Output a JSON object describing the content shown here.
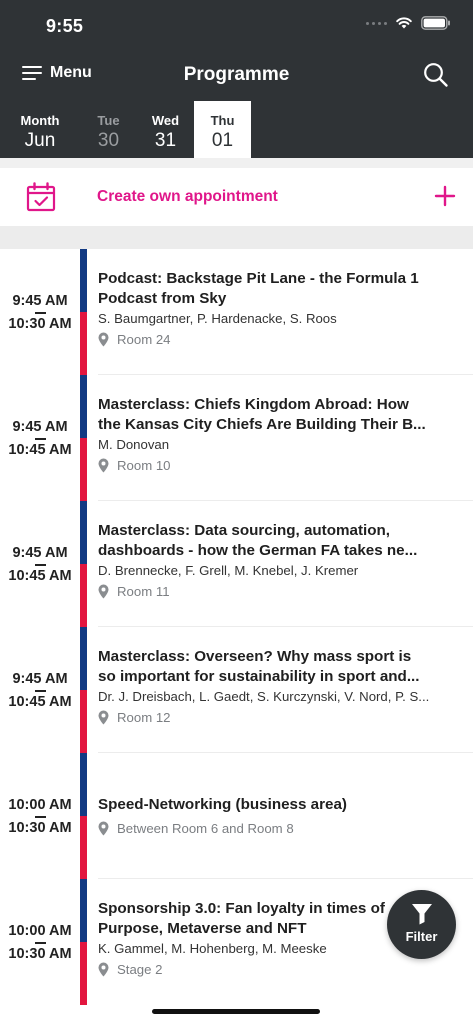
{
  "status": {
    "time": "9:55"
  },
  "nav": {
    "menu_label": "Menu",
    "title": "Programme"
  },
  "date_tabs": [
    {
      "top": "Month",
      "bottom": "Jun"
    },
    {
      "top": "Tue",
      "bottom": "30"
    },
    {
      "top": "Wed",
      "bottom": "31"
    },
    {
      "top": "Thu",
      "bottom": "01"
    }
  ],
  "create": {
    "label": "Create own appointment"
  },
  "sessions": [
    {
      "start": "9:45 AM",
      "end": "10:30 AM",
      "title1": "Podcast: Backstage Pit Lane - the Formula 1",
      "title2": "Podcast from Sky",
      "speakers": "S. Baumgartner, P. Hardenacke, S. Roos",
      "room": "Room 24"
    },
    {
      "start": "9:45 AM",
      "end": "10:45 AM",
      "title1": "Masterclass: Chiefs Kingdom Abroad: How",
      "title2": "the Kansas City Chiefs Are Building Their B...",
      "speakers": "M. Donovan",
      "room": "Room 10"
    },
    {
      "start": "9:45 AM",
      "end": "10:45 AM",
      "title1": "Masterclass: Data sourcing, automation,",
      "title2": "dashboards - how the German FA takes ne...",
      "speakers": "D. Brennecke, F. Grell, M. Knebel, J. Kremer",
      "room": "Room 11"
    },
    {
      "start": "9:45 AM",
      "end": "10:45 AM",
      "title1": "Masterclass: Overseen? Why mass sport is",
      "title2": "so important for sustainability in sport and...",
      "speakers": "Dr. J. Dreisbach, L. Gaedt, S. Kurczynski, V. Nord, P. S...",
      "room": "Room 12"
    },
    {
      "start": "10:00 AM",
      "end": "10:30 AM",
      "title1": "Speed-Networking (business area)",
      "title2": "",
      "speakers": "",
      "room": "Between Room 6 and Room 8"
    },
    {
      "start": "10:00 AM",
      "end": "10:30 AM",
      "title1": "Sponsorship 3.0: Fan loyalty in times of",
      "title2": "Purpose, Metaverse and NFT",
      "speakers": "K. Gammel, M. Hohenberg, M. Meeske",
      "room": "Stage 2"
    }
  ],
  "filter": {
    "label": "Filter"
  },
  "colors": {
    "dark": "#2f3336",
    "accent": "#e0168a",
    "bar_blue": "#123a83",
    "bar_red": "#e2163f"
  },
  "icons": {
    "menu": "hamburger-icon",
    "search": "search-icon",
    "calendar": "calendar-check-icon",
    "plus": "plus-icon",
    "location": "location-pin-icon",
    "filter": "funnel-icon"
  }
}
